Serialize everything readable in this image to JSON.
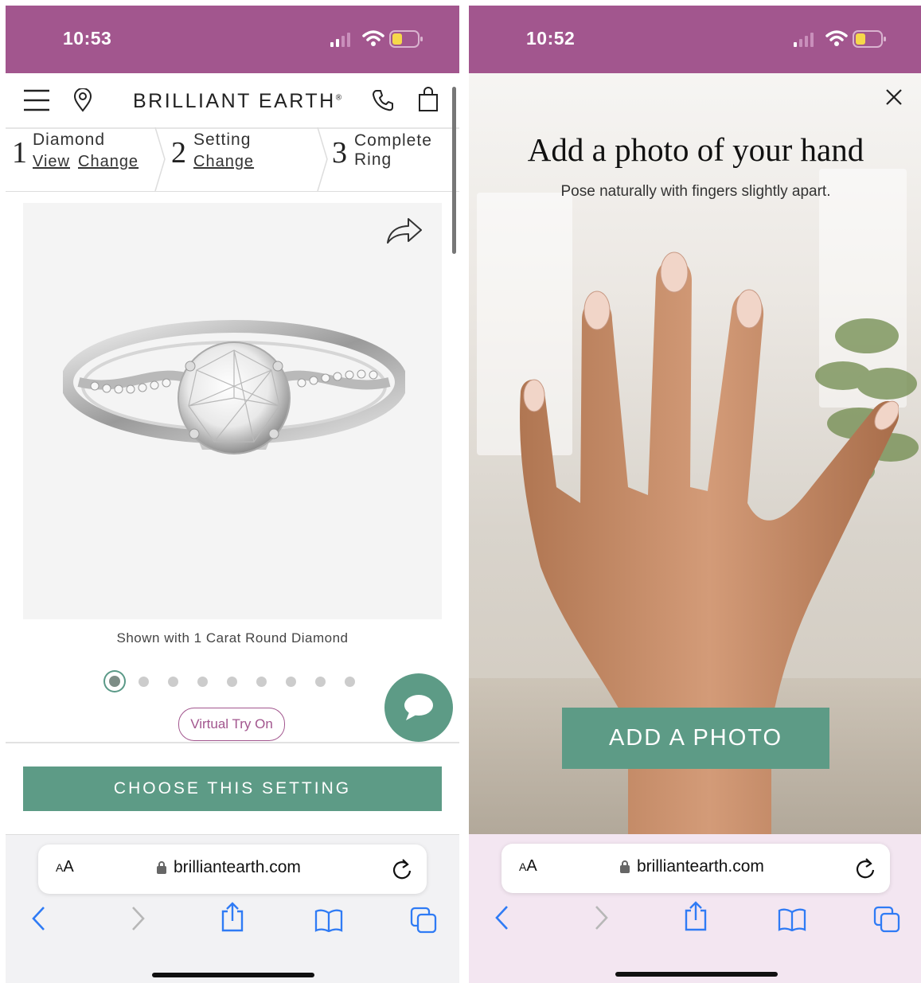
{
  "left": {
    "status": {
      "time": "10:53"
    },
    "header": {
      "brand": "BRILLIANT EARTH",
      "brand_mark": "®"
    },
    "steps": [
      {
        "num": "1",
        "title": "Diamond",
        "links": [
          "View",
          "Change"
        ]
      },
      {
        "num": "2",
        "title": "Setting",
        "links": [
          "Change"
        ]
      },
      {
        "num": "3",
        "title": "Complete",
        "title2": "Ring"
      }
    ],
    "caption": "Shown with 1 Carat Round Diamond",
    "dots": {
      "count": 9,
      "active": 0
    },
    "virtual_try_on": "Virtual Try On",
    "cta": "CHOOSE THIS SETTING",
    "browser": {
      "aa": "A",
      "aa_big": "A",
      "host": "brilliantearth.com"
    }
  },
  "right": {
    "status": {
      "time": "10:52"
    },
    "title": "Add a photo of your hand",
    "subtitle": "Pose naturally with fingers slightly apart.",
    "button": "ADD A PHOTO",
    "browser": {
      "aa": "A",
      "aa_big": "A",
      "host": "brilliantearth.com"
    }
  },
  "colors": {
    "status_bg": "#a2568e",
    "accent_green": "#5d9b86",
    "purple_text": "#a2568e"
  }
}
